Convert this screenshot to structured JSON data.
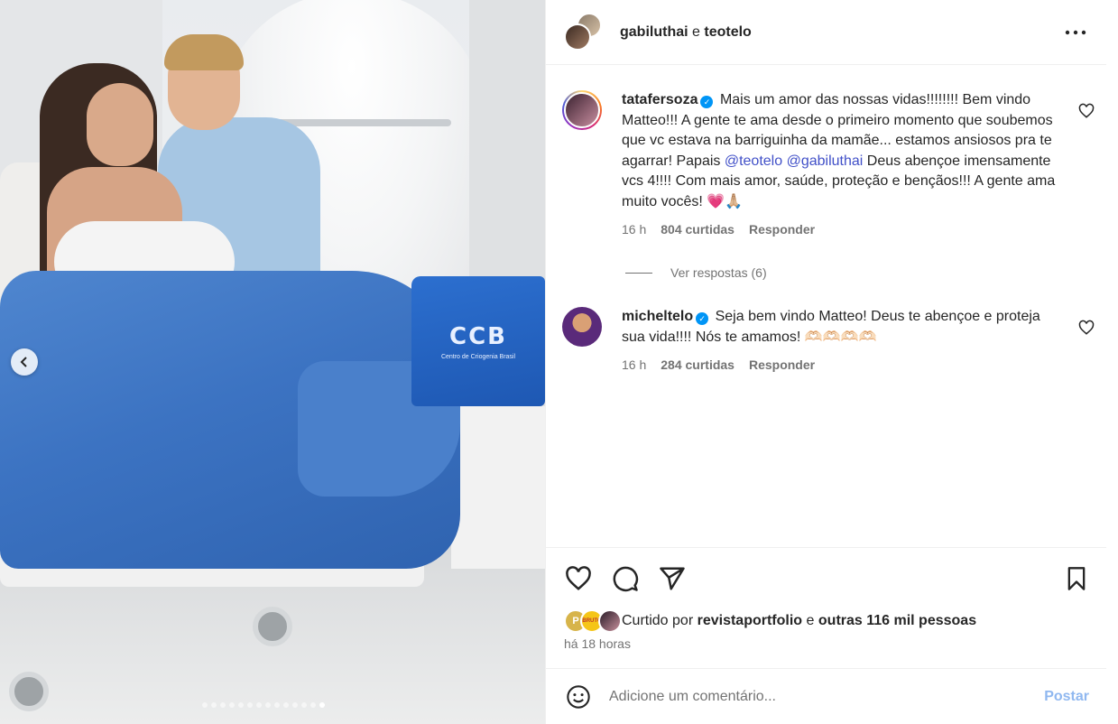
{
  "header": {
    "user1": "gabiluthai",
    "separator": "e",
    "user2": "teotelo",
    "more_icon": "more-horizontal-icon"
  },
  "photo": {
    "bag_logo": "CCB",
    "bag_text": "Centro de Criogenia Brasil",
    "carousel_total": 14,
    "carousel_active_index": 13
  },
  "comments": [
    {
      "username": "tatafersoza",
      "verified": true,
      "text_part1": "Mais um amor das nossas vidas!!!!!!!! Bem vindo Matteo!!! A gente te ama desde o primeiro momento que soubemos que vc estava na barriguinha da mamãe... estamos ansiosos pra te agarrar! Papais ",
      "mention1": "@teotelo",
      "mention2": "@gabiluthai",
      "text_part2": " Deus abençoe imensamente vcs 4!!!! Com mais amor, saúde, proteção e bençãos!!! A gente ama muito vocês! ",
      "emoji": "💗🙏🏼",
      "time": "16 h",
      "likes": "804 curtidas",
      "reply": "Responder",
      "view_replies": "Ver respostas (6)"
    },
    {
      "username": "micheltelo",
      "verified": true,
      "text": "Seja bem vindo Matteo! Deus te abençoe e proteja sua vida!!!! Nós te amamos! ",
      "emoji": "🫶🏻🫶🏻🫶🏻🫶🏻",
      "time": "16 h",
      "likes": "284 curtidas",
      "reply": "Responder"
    }
  ],
  "actions": {
    "like_icon": "heart-icon",
    "comment_icon": "comment-icon",
    "share_icon": "send-icon",
    "save_icon": "bookmark-icon"
  },
  "likes": {
    "prefix": "Curtido por",
    "user": "revistaportfolio",
    "middle": "e",
    "others": "outras 116 mil pessoas",
    "avatar1_letter": "P",
    "avatar2_text": "BRUTO"
  },
  "time_ago": "há 18 horas",
  "add_comment": {
    "placeholder": "Adicione um comentário...",
    "post_label": "Postar",
    "post_color": "#90b8f0"
  }
}
